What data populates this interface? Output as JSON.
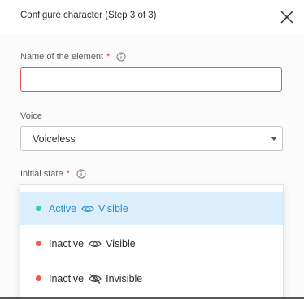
{
  "header": {
    "title": "Configure character (Step 3 of 3)"
  },
  "form": {
    "name_label": "Name of the element",
    "name_required": "*",
    "name_value": "",
    "voice_label": "Voice",
    "voice_value": "Voiceless",
    "state_label": "Initial state",
    "state_required": "*"
  },
  "dropdown": {
    "options": [
      {
        "status": "Active",
        "visibility": "Visible",
        "dot_color": "#2fd3a6",
        "icon": "eye-icon",
        "selected": true
      },
      {
        "status": "Inactive",
        "visibility": "Visible",
        "dot_color": "#f05a4a",
        "icon": "eye-icon",
        "selected": false
      },
      {
        "status": "Inactive",
        "visibility": "Invisible",
        "dot_color": "#f05a4a",
        "icon": "eye-slash-icon",
        "selected": false
      }
    ]
  },
  "colors": {
    "accent": "#2a8fcf",
    "selected_bg": "#dceefb",
    "error_border": "#e05a5a",
    "required": "#e34b4b"
  }
}
